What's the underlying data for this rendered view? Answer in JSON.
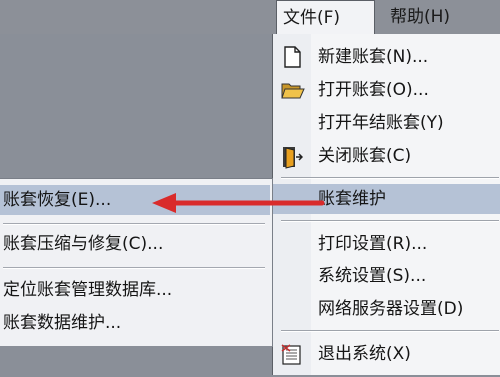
{
  "menubar": {
    "file_label": "文件(F)",
    "help_label": "帮助(H)"
  },
  "file_menu": {
    "items": [
      {
        "label": "新建账套(N)...",
        "icon": "new-document-icon"
      },
      {
        "label": "打开账套(O)...",
        "icon": "open-folder-icon"
      },
      {
        "label": "打开年结账套(Y)",
        "icon": ""
      },
      {
        "label": "关闭账套(C)",
        "icon": "close-door-icon"
      },
      {
        "label": "账套维护",
        "icon": ""
      },
      {
        "label": "打印设置(R)...",
        "icon": ""
      },
      {
        "label": "系统设置(S)...",
        "icon": ""
      },
      {
        "label": "网络服务器设置(D)",
        "icon": ""
      },
      {
        "label": "退出系统(X)",
        "icon": "exit-icon"
      }
    ]
  },
  "submenu": {
    "items": [
      {
        "label": "账套恢复(E)..."
      },
      {
        "label": "账套压缩与修复(C)..."
      },
      {
        "label": "定位账套管理数据库..."
      },
      {
        "label": "账套数据维护..."
      }
    ]
  },
  "colors": {
    "arrow": "#d92b2b",
    "highlight": "#b5c2d6",
    "menu_bg": "#f4f5f7"
  }
}
